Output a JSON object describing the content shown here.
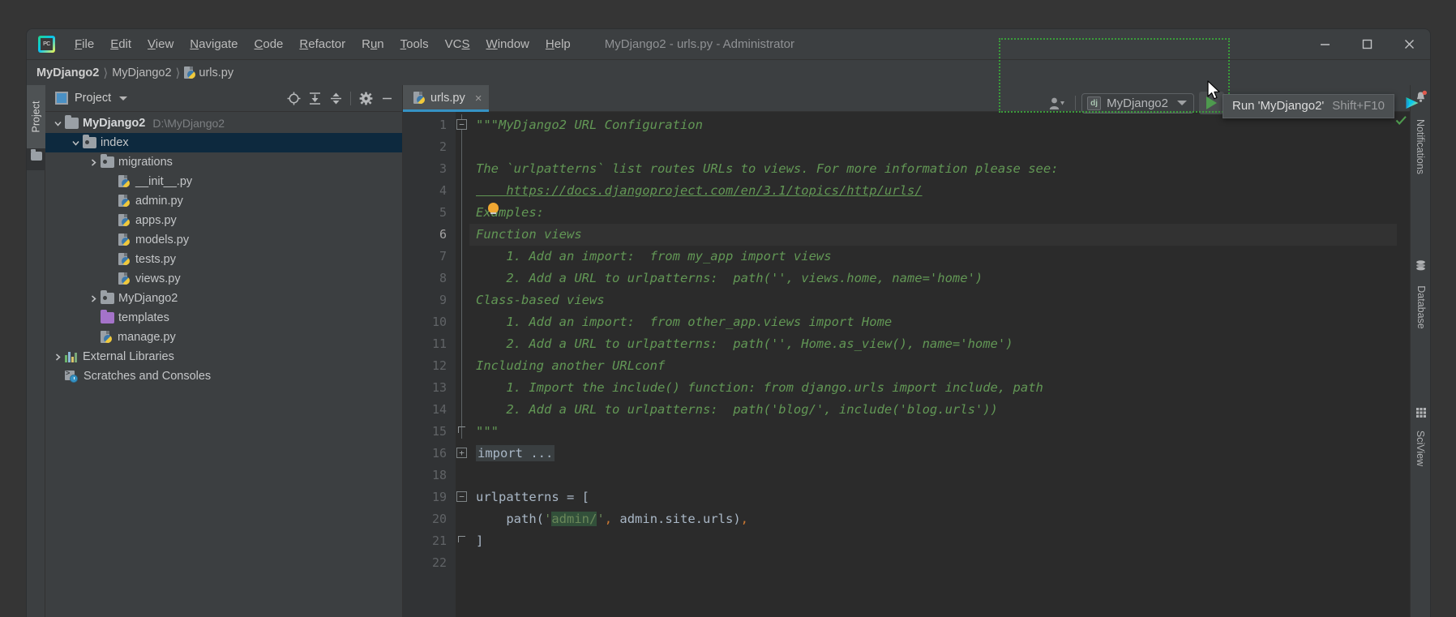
{
  "window": {
    "title": "MyDjango2 - urls.py - Administrator",
    "controls": {
      "minimize": "minimize-icon",
      "maximize": "maximize-icon",
      "close": "close-icon"
    }
  },
  "menubar": {
    "logo": "pycharm-logo",
    "items": [
      {
        "label": "File",
        "mnemonic_index": 0
      },
      {
        "label": "Edit",
        "mnemonic_index": 0
      },
      {
        "label": "View",
        "mnemonic_index": 0
      },
      {
        "label": "Navigate",
        "mnemonic_index": 0
      },
      {
        "label": "Code",
        "mnemonic_index": 0
      },
      {
        "label": "Refactor",
        "mnemonic_index": 0
      },
      {
        "label": "Run",
        "mnemonic_index": 1
      },
      {
        "label": "Tools",
        "mnemonic_index": 0
      },
      {
        "label": "VCS",
        "mnemonic_index": 2
      },
      {
        "label": "Window",
        "mnemonic_index": 0
      },
      {
        "label": "Help",
        "mnemonic_index": 0
      }
    ]
  },
  "breadcrumb": {
    "items": [
      "MyDjango2",
      "MyDjango2",
      "urls.py"
    ],
    "separator": "〉"
  },
  "toolbar": {
    "user_icon": "user-icon",
    "run_config": {
      "icon_text": "dj",
      "name": "MyDjango2",
      "dropdown": "chevron-down-icon"
    },
    "buttons": [
      {
        "name": "run-button",
        "icon": "play-icon"
      },
      {
        "name": "debug-button",
        "icon": "bug-icon"
      },
      {
        "name": "coverage-button",
        "icon": "coverage-icon"
      },
      {
        "name": "profile-button",
        "icon": "profile-icon"
      },
      {
        "name": "stop-button",
        "icon": "stop-icon"
      },
      {
        "name": "search-everywhere-button",
        "icon": "search-icon"
      },
      {
        "name": "settings-button",
        "icon": "gear-icon"
      },
      {
        "name": "updates-button",
        "icon": "colored-triangle-icon"
      }
    ]
  },
  "tooltip": {
    "text": "Run 'MyDjango2'",
    "shortcut": "Shift+F10"
  },
  "highlight": {
    "color": "#3a9c3a",
    "style": "dotted"
  },
  "left_strip": {
    "tabs": [
      {
        "label": "Project",
        "name": "tool-window-project"
      }
    ],
    "folder_icon": "folder-icon"
  },
  "right_strip": {
    "tabs": [
      {
        "label": "Notifications",
        "icon": "bell-icon",
        "badge": true
      },
      {
        "label": "Database",
        "icon": "database-icon",
        "badge": false
      },
      {
        "label": "SciView",
        "icon": "grid-icon",
        "badge": false
      }
    ]
  },
  "project_panel": {
    "title": "Project",
    "title_icon": "project-icon",
    "dropdown_icon": "chevron-down-icon",
    "actions": [
      {
        "name": "select-opened-file-button",
        "icon": "crosshair-icon"
      },
      {
        "name": "expand-all-button",
        "icon": "expand-all-icon"
      },
      {
        "name": "collapse-all-button",
        "icon": "collapse-all-icon"
      },
      {
        "name": "panel-settings-button",
        "icon": "gear-icon"
      },
      {
        "name": "hide-panel-button",
        "icon": "minimize-icon"
      }
    ],
    "tree": [
      {
        "label": "MyDjango2",
        "path": "D:\\MyDjango2",
        "indent": 0,
        "arrow": "down",
        "icon": "folder",
        "bold": true,
        "selected": false
      },
      {
        "label": "index",
        "path": "",
        "indent": 1,
        "arrow": "down",
        "icon": "folder-source",
        "bold": false,
        "selected": true
      },
      {
        "label": "migrations",
        "path": "",
        "indent": 2,
        "arrow": "right",
        "icon": "folder-source",
        "bold": false,
        "selected": false
      },
      {
        "label": "__init__.py",
        "path": "",
        "indent": 3,
        "arrow": "none",
        "icon": "python",
        "bold": false,
        "selected": false
      },
      {
        "label": "admin.py",
        "path": "",
        "indent": 3,
        "arrow": "none",
        "icon": "python",
        "bold": false,
        "selected": false
      },
      {
        "label": "apps.py",
        "path": "",
        "indent": 3,
        "arrow": "none",
        "icon": "python",
        "bold": false,
        "selected": false
      },
      {
        "label": "models.py",
        "path": "",
        "indent": 3,
        "arrow": "none",
        "icon": "python",
        "bold": false,
        "selected": false
      },
      {
        "label": "tests.py",
        "path": "",
        "indent": 3,
        "arrow": "none",
        "icon": "python",
        "bold": false,
        "selected": false
      },
      {
        "label": "views.py",
        "path": "",
        "indent": 3,
        "arrow": "none",
        "icon": "python",
        "bold": false,
        "selected": false
      },
      {
        "label": "MyDjango2",
        "path": "",
        "indent": 2,
        "arrow": "right",
        "icon": "folder-source",
        "bold": false,
        "selected": false
      },
      {
        "label": "templates",
        "path": "",
        "indent": 2,
        "arrow": "none",
        "icon": "folder-purple",
        "bold": false,
        "selected": false
      },
      {
        "label": "manage.py",
        "path": "",
        "indent": 2,
        "arrow": "none",
        "icon": "python",
        "bold": false,
        "selected": false
      },
      {
        "label": "External Libraries",
        "path": "",
        "indent": 0,
        "arrow": "right",
        "icon": "library",
        "bold": false,
        "selected": false
      },
      {
        "label": "Scratches and Consoles",
        "path": "",
        "indent": 0,
        "arrow": "none",
        "icon": "scratch",
        "bold": false,
        "selected": false
      }
    ]
  },
  "editor": {
    "tab": {
      "label": "urls.py",
      "icon": "python",
      "close": "×",
      "active": true
    },
    "inspection_status": "ok-checkmark",
    "current_line": 6,
    "line_numbers": [
      1,
      2,
      3,
      4,
      5,
      6,
      7,
      8,
      9,
      10,
      11,
      12,
      13,
      14,
      15,
      16,
      18,
      19,
      20,
      21,
      22
    ],
    "lines": [
      {
        "n": 1,
        "text": "\"\"\"MyDjango2 URL Configuration"
      },
      {
        "n": 2,
        "text": ""
      },
      {
        "n": 3,
        "text": "The `urlpatterns` list routes URLs to views. For more information please see:"
      },
      {
        "n": 4,
        "text": "    https://docs.djangoproject.com/en/3.1/topics/http/urls/"
      },
      {
        "n": 5,
        "text": "Examples:"
      },
      {
        "n": 6,
        "text": "Function views"
      },
      {
        "n": 7,
        "text": "    1. Add an import:  from my_app import views"
      },
      {
        "n": 8,
        "text": "    2. Add a URL to urlpatterns:  path('', views.home, name='home')"
      },
      {
        "n": 9,
        "text": "Class-based views"
      },
      {
        "n": 10,
        "text": "    1. Add an import:  from other_app.views import Home"
      },
      {
        "n": 11,
        "text": "    2. Add a URL to urlpatterns:  path('', Home.as_view(), name='home')"
      },
      {
        "n": 12,
        "text": "Including another URLconf"
      },
      {
        "n": 13,
        "text": "    1. Import the include() function: from django.urls import include, path"
      },
      {
        "n": 14,
        "text": "    2. Add a URL to urlpatterns:  path('blog/', include('blog.urls'))"
      },
      {
        "n": 15,
        "text": "\"\"\""
      },
      {
        "n": 16,
        "text": "import ...",
        "folded": true
      },
      {
        "n": 18,
        "text": ""
      },
      {
        "n": 19,
        "text": "urlpatterns = ["
      },
      {
        "n": 20,
        "text": "    path('admin/', admin.site.urls),"
      },
      {
        "n": 21,
        "text": "]"
      },
      {
        "n": 22,
        "text": ""
      }
    ],
    "intention_bulb": {
      "line": 5,
      "icon": "lightbulb-icon",
      "color": "#f0a732"
    },
    "highlighted_string": "admin/"
  },
  "colors": {
    "accent_blue": "#3592c4",
    "selection_blue": "#0d293e",
    "editor_bg": "#2b2b2b",
    "panel_bg": "#3c3f41",
    "docstring_green": "#629755",
    "string_green": "#6a8759",
    "keyword_orange": "#cc7832",
    "run_green": "#4e9a4e"
  }
}
